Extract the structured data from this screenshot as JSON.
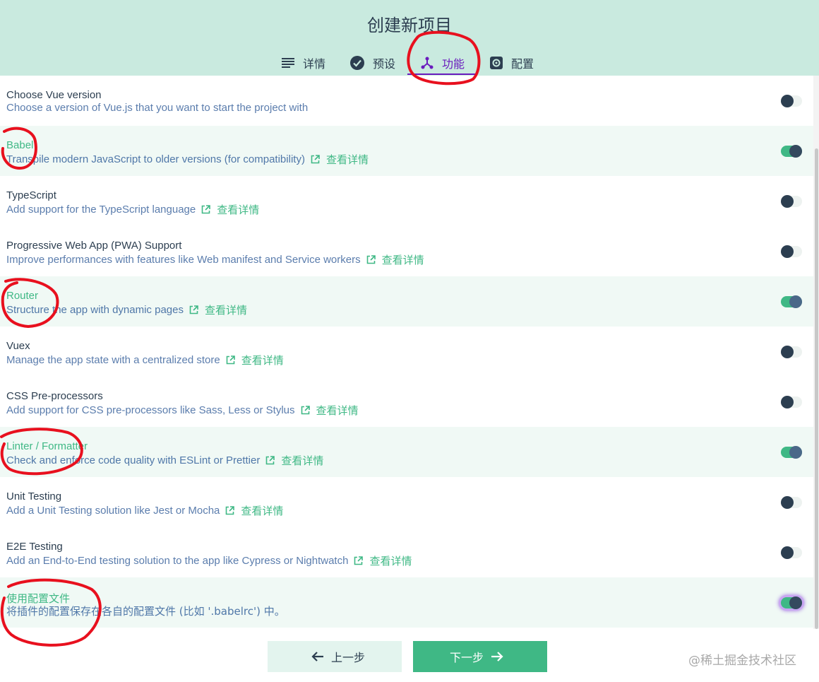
{
  "title": "创建新项目",
  "tabs": [
    {
      "label": "详情",
      "icon": "list-icon"
    },
    {
      "label": "预设",
      "icon": "check-circle-icon"
    },
    {
      "label": "功能",
      "icon": "branch-icon",
      "active": true
    },
    {
      "label": "配置",
      "icon": "gear-icon"
    }
  ],
  "details_link": "查看详情",
  "features": [
    {
      "name": "Choose Vue version",
      "desc": "Choose a version of Vue.js that you want to start the project with",
      "enabled": false,
      "link": false
    },
    {
      "name": "Babel",
      "desc": "Transpile modern JavaScript to older versions (for compatibility)",
      "enabled": true,
      "link": true
    },
    {
      "name": "TypeScript",
      "desc": "Add support for the TypeScript language",
      "enabled": false,
      "link": true
    },
    {
      "name": "Progressive Web App (PWA) Support",
      "desc": "Improve performances with features like Web manifest and Service workers",
      "enabled": false,
      "link": true
    },
    {
      "name": "Router",
      "desc": "Structure the app with dynamic pages",
      "enabled": true,
      "link": true
    },
    {
      "name": "Vuex",
      "desc": "Manage the app state with a centralized store",
      "enabled": false,
      "link": true
    },
    {
      "name": "CSS Pre-processors",
      "desc": "Add support for CSS pre-processors like Sass, Less or Stylus",
      "enabled": false,
      "link": true
    },
    {
      "name": "Linter / Formatter",
      "desc": "Check and enforce code quality with ESLint or Prettier",
      "enabled": true,
      "link": true
    },
    {
      "name": "Unit Testing",
      "desc": "Add a Unit Testing solution like Jest or Mocha",
      "enabled": false,
      "link": true
    },
    {
      "name": "E2E Testing",
      "desc": "Add an End-to-End testing solution to the app like Cypress or Nightwatch",
      "enabled": false,
      "link": true
    },
    {
      "name": "使用配置文件",
      "desc": "将插件的配置保存在各自的配置文件 (比如 '.babelrc') 中。",
      "enabled": true,
      "link": false
    }
  ],
  "footer": {
    "prev_label": "上一步",
    "next_label": "下一步",
    "watermark": "@稀土掘金技术社区"
  },
  "colors": {
    "header_bg": "#c9eadf",
    "accent_green": "#3fb885",
    "active_tab": "#6a1bbd",
    "text_dark": "#2c3e50",
    "desc_blue": "#5b7dad",
    "annotation_red": "#e8101e"
  }
}
